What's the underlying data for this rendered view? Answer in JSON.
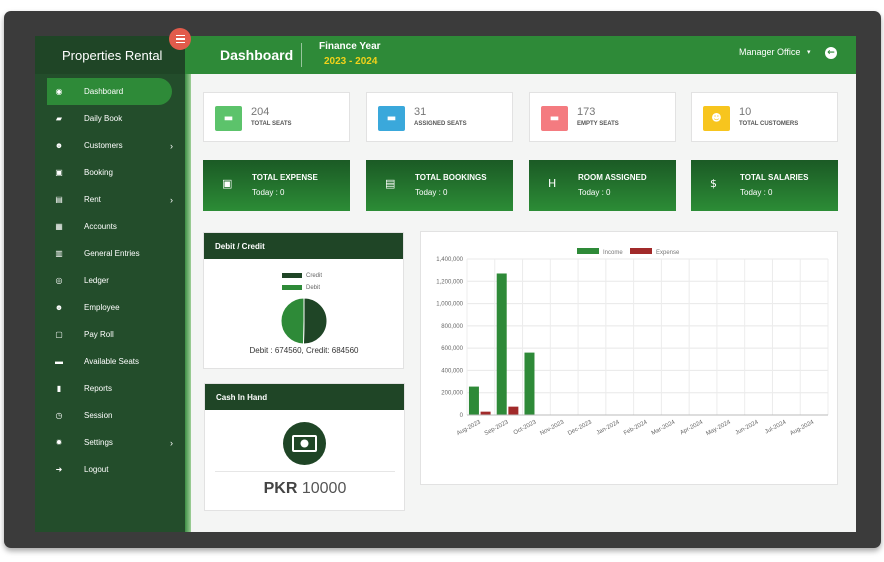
{
  "sidebar": {
    "brand": "Properties Rental",
    "items": [
      {
        "label": "Dashboard",
        "icon": "dashboard-icon",
        "glyph": "◉",
        "active": true,
        "submenu": false
      },
      {
        "label": "Daily Book",
        "icon": "book-icon",
        "glyph": "▰",
        "submenu": false
      },
      {
        "label": "Customers",
        "icon": "users-icon",
        "glyph": "☻",
        "submenu": true
      },
      {
        "label": "Booking",
        "icon": "calendar-icon",
        "glyph": "▣",
        "submenu": false
      },
      {
        "label": "Rent",
        "icon": "money-icon",
        "glyph": "▤",
        "submenu": true
      },
      {
        "label": "Accounts",
        "icon": "file-icon",
        "glyph": "▦",
        "submenu": false
      },
      {
        "label": "General Entries",
        "icon": "bank-icon",
        "glyph": "▥",
        "submenu": false
      },
      {
        "label": "Ledger",
        "icon": "eye-icon",
        "glyph": "◎",
        "submenu": false
      },
      {
        "label": "Employee",
        "icon": "users-icon",
        "glyph": "☻",
        "submenu": false
      },
      {
        "label": "Pay Roll",
        "icon": "file-icon",
        "glyph": "▢",
        "submenu": false
      },
      {
        "label": "Available Seats",
        "icon": "bed-icon",
        "glyph": "▬",
        "submenu": false
      },
      {
        "label": "Reports",
        "icon": "document-icon",
        "glyph": "▮",
        "submenu": false
      },
      {
        "label": "Session",
        "icon": "clock-icon",
        "glyph": "◷",
        "submenu": false
      },
      {
        "label": "Settings",
        "icon": "gear-icon",
        "glyph": "✹",
        "submenu": true
      },
      {
        "label": "Logout",
        "icon": "logout-icon",
        "glyph": "➜",
        "submenu": false
      }
    ],
    "chevron": "›"
  },
  "header": {
    "title": "Dashboard",
    "finance_label": "Finance Year",
    "finance_value": "2023 - 2024",
    "office": "Manager Office",
    "caret": "▾",
    "back_glyph": "←"
  },
  "stats": [
    {
      "value": "204",
      "label": "TOTAL SEATS",
      "color": "#5cc36b",
      "icon": "bed-icon",
      "glyph": "▬"
    },
    {
      "value": "31",
      "label": "ASSIGNED SEATS",
      "color": "#3aa8db",
      "icon": "bed-icon",
      "glyph": "▬"
    },
    {
      "value": "173",
      "label": "EMPTY SEATS",
      "color": "#f47b80",
      "icon": "bed-icon",
      "glyph": "▬"
    },
    {
      "value": "10",
      "label": "TOTAL CUSTOMERS",
      "color": "#f7c51e",
      "icon": "users-icon",
      "glyph": "☻"
    }
  ],
  "summary": [
    {
      "title": "TOTAL EXPENSE",
      "sub": "Today : 0",
      "icon": "money-icon",
      "glyph": "▣"
    },
    {
      "title": "TOTAL BOOKINGS",
      "sub": "Today : 0",
      "icon": "calendar-icon",
      "glyph": "▤"
    },
    {
      "title": "ROOM ASSIGNED",
      "sub": "Today : 0",
      "icon": "hotel-icon",
      "glyph": "H"
    },
    {
      "title": "TOTAL SALARIES",
      "sub": "Today : 0",
      "icon": "dollar-icon",
      "glyph": "$"
    }
  ],
  "debit_credit": {
    "title": "Debit / Credit",
    "summary": "Debit : 674560, Credit: 684560",
    "legend": [
      "Credit",
      "Debit"
    ],
    "colors": {
      "Credit": "#1f4526",
      "Debit": "#2e8a38"
    }
  },
  "cash": {
    "title": "Cash In Hand",
    "currency": "PKR",
    "amount": "10000",
    "icon": "cash-icon"
  },
  "chart_data": [
    {
      "type": "pie",
      "labels": [
        "Credit",
        "Debit"
      ],
      "values": [
        684560,
        674560
      ]
    },
    {
      "type": "bar",
      "categories": [
        "Aug-2023",
        "Sep-2023",
        "Oct-2023",
        "Nov-2023",
        "Dec-2023",
        "Jan-2024",
        "Feb-2024",
        "Mar-2024",
        "Apr-2024",
        "May-2024",
        "Jun-2024",
        "Jul-2024",
        "Aug-2024"
      ],
      "series": [
        {
          "name": "Income",
          "color": "#2e8a38",
          "values": [
            255000,
            1270000,
            560000,
            0,
            0,
            0,
            0,
            0,
            0,
            0,
            0,
            0,
            0
          ]
        },
        {
          "name": "Expense",
          "color": "#a12a2a",
          "values": [
            30000,
            75000,
            0,
            0,
            0,
            0,
            0,
            0,
            0,
            0,
            0,
            0,
            0
          ]
        }
      ],
      "ylim": [
        0,
        1400000
      ],
      "yticks": [
        "0",
        "200,000",
        "400,000",
        "600,000",
        "800,000",
        "1,000,000",
        "1,200,000",
        "1,400,000"
      ],
      "grid": true,
      "legend_position": "top"
    }
  ]
}
